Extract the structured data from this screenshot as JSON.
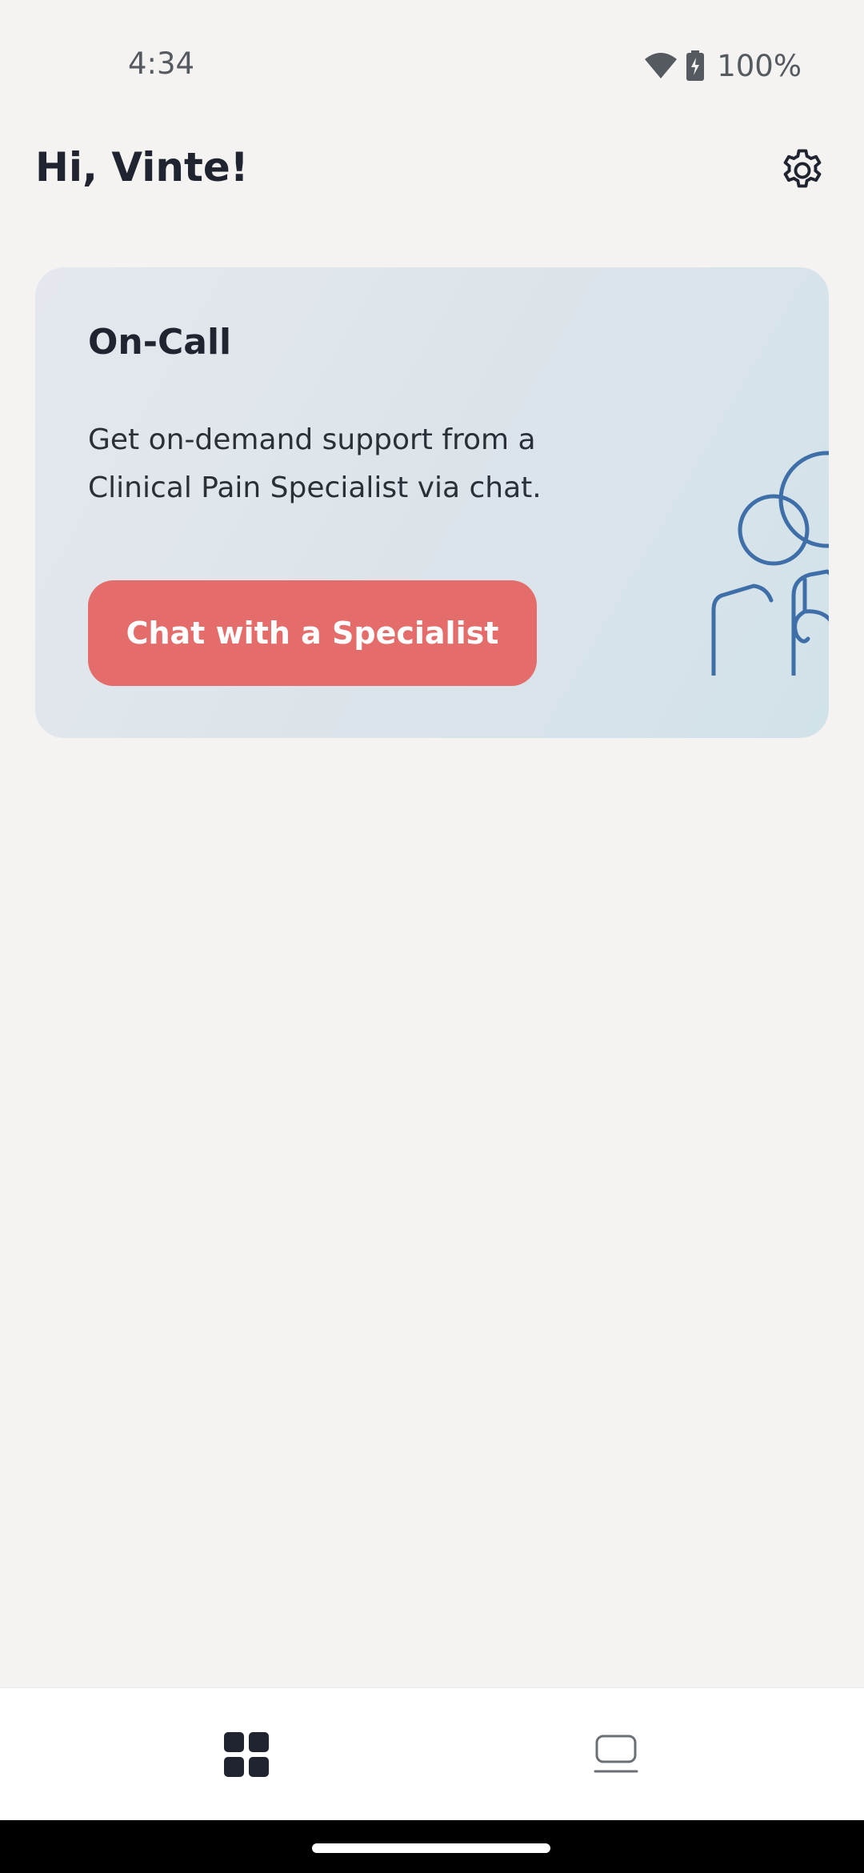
{
  "status_bar": {
    "time": "4:34",
    "battery_percent": "100%",
    "icons": [
      "wifi-icon",
      "battery-charging-icon"
    ]
  },
  "header": {
    "greeting": "Hi, Vinte!",
    "settings_icon": "gear-icon"
  },
  "on_call_card": {
    "title": "On-Call",
    "description": "Get on-demand support from a Clinical Pain Specialist via chat.",
    "button_label": "Chat with a Specialist",
    "illustration": "clinicians-icon"
  },
  "bottom_nav": {
    "items": [
      {
        "icon": "dashboard-grid-icon",
        "active": true
      },
      {
        "icon": "laptop-icon",
        "active": false
      }
    ]
  },
  "colors": {
    "background": "#f4f3f1",
    "accent_button": "#e46d6b",
    "illustration_stroke": "#3f6fa8",
    "text_primary": "#1f2430"
  }
}
